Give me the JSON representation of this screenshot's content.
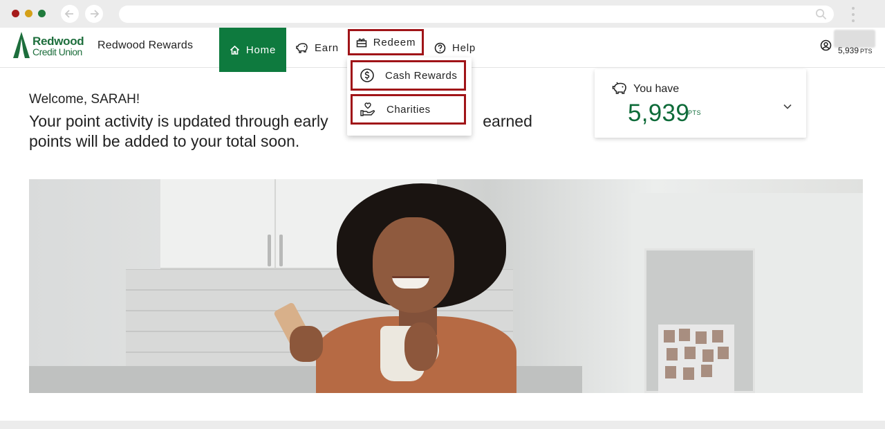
{
  "browser": {
    "url": "",
    "colors": {
      "close": "#a61b1b",
      "minimize": "#d4a017",
      "maximize": "#1f7a3c"
    }
  },
  "logo": {
    "line1": "Redwood",
    "line2": "Credit Union"
  },
  "header": {
    "brand": "Redwood Rewards",
    "nav": [
      {
        "label": "Home",
        "icon": "home-icon",
        "active": true
      },
      {
        "label": "Earn",
        "icon": "piggy-bank-icon"
      },
      {
        "label": "Redeem",
        "icon": "gift-box-icon",
        "highlighted": true
      },
      {
        "label": "Help",
        "icon": "question-circle-icon"
      }
    ],
    "account": {
      "points": "5,939",
      "unit": "PTS",
      "icon": "user-circle-icon"
    }
  },
  "redeem_menu": {
    "items": [
      {
        "label": "Cash Rewards",
        "icon": "dollar-circle-icon"
      },
      {
        "label": "Charities",
        "icon": "hand-heart-icon"
      }
    ]
  },
  "main": {
    "welcome": "Welcome, SARAH!",
    "message": "Your point activity is updated through early                                   earned points will be added to your total soon."
  },
  "points_card": {
    "label": "You have",
    "value": "5,939",
    "unit": "PTS",
    "icon": "piggy-bank-icon"
  },
  "theme": {
    "brand_green": "#0e7a3e",
    "highlight_red": "#a01418"
  }
}
